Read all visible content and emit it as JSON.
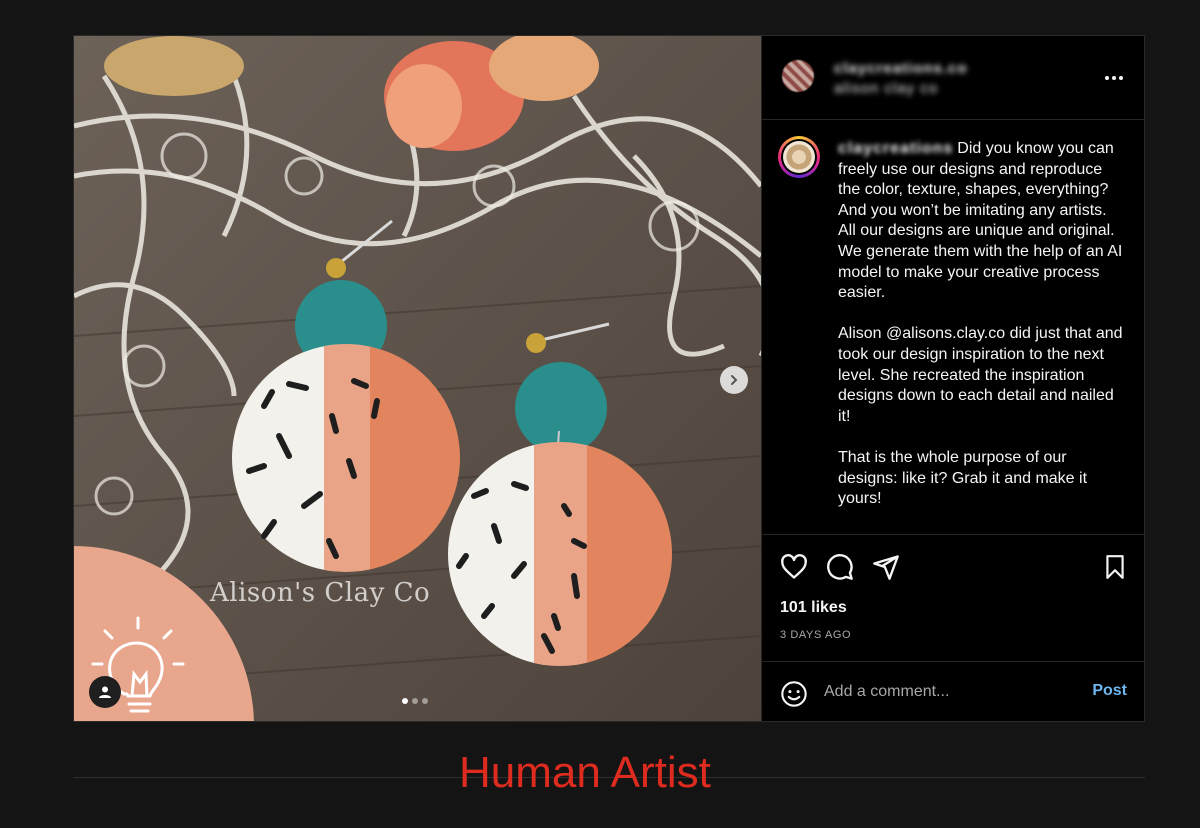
{
  "post": {
    "watermark": "Alison's Clay Co",
    "carousel": {
      "slides": 3,
      "active_slide": 1
    }
  },
  "header": {
    "username_blurred": "claycreations.co",
    "subtitle_blurred": "alison clay co",
    "more_icon": "more-horizontal-icon"
  },
  "caption": {
    "username_blurred": "claycreations",
    "paragraphs": [
      "Did you know you can freely use our designs and reproduce the color, texture, shapes, everything? And you won’t be imitating any artists. All our designs are unique and original. We generate them with the help of an AI model to make your creative process easier.",
      "Alison @alisons.clay.co did just that and took our design inspiration to the next level. She recreated the inspiration designs down to each detail and nailed it!",
      "That is the whole purpose of our designs: like it? Grab it and make it yours!"
    ]
  },
  "actions": {
    "icons": [
      "heart-icon",
      "comment-icon",
      "share-icon",
      "bookmark-icon"
    ],
    "likes": "101 likes",
    "time_ago": "3 DAYS AGO"
  },
  "comment": {
    "placeholder": "Add a comment...",
    "post_label": "Post"
  },
  "footer": {
    "label": "Human Artist"
  },
  "colors": {
    "background": "#141414",
    "post_link": "#6fb6ee",
    "footer_label": "#de2b1f",
    "badge": "#e8a68d"
  }
}
